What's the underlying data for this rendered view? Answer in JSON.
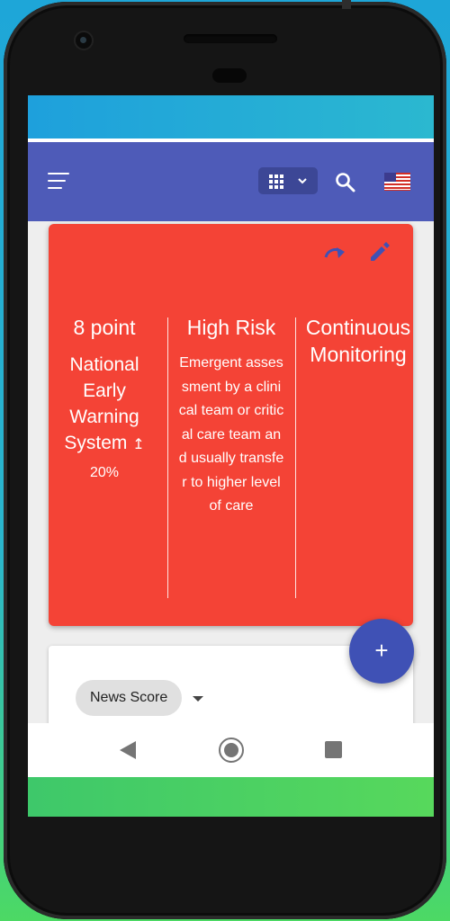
{
  "app_bar": {
    "menu_icon": "hamburger-menu-icon",
    "view_icon": "grid-view-icon",
    "dropdown_icon": "chevron-down-icon",
    "search_icon": "search-icon",
    "language_icon": "us-flag-icon"
  },
  "card": {
    "actions": [
      "redo-icon",
      "edit-pencil-icon"
    ],
    "score": {
      "title": "8 point",
      "subtitle": "National Early Warning System",
      "trend_arrow": "↥",
      "trend_value": "20%"
    },
    "risk": {
      "title": "High Risk",
      "description": "Emergent assessment by a clinical team or critical care team and usually transfer to higher level of care"
    },
    "monitoring": {
      "title": "Continuous Monitoring"
    },
    "colors": {
      "background": "#f44336",
      "action_icon": "#3f51b5"
    }
  },
  "panel": {
    "chip_label": "News Score",
    "chip_dropdown_icon": "caret-down-icon"
  },
  "fab": {
    "icon": "add-icon",
    "label": "+"
  },
  "nav_bar": {
    "back_icon": "back-triangle-icon",
    "home_icon": "home-circle-icon",
    "recent_icon": "recent-apps-icon"
  },
  "theme": {
    "primary": "#4e5bb8",
    "accent": "#3f51b5"
  }
}
